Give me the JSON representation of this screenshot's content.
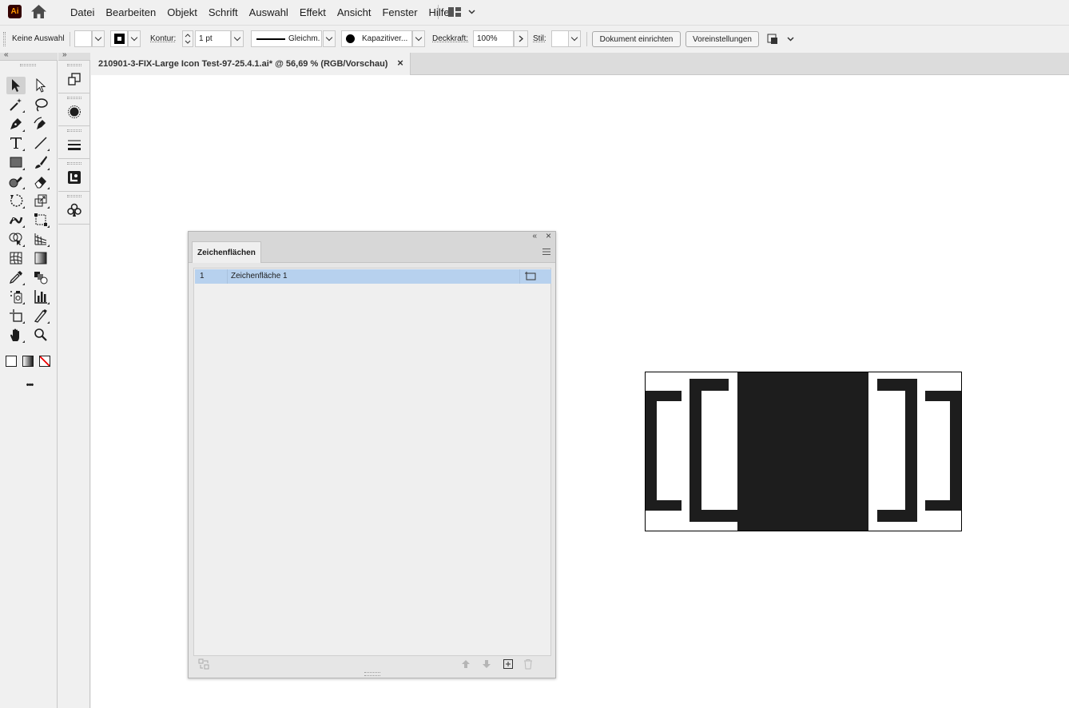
{
  "app": {
    "logo_text": "Ai",
    "brand_color": "#ff9a00",
    "logo_bg": "#330000"
  },
  "menu": {
    "items": [
      "Datei",
      "Bearbeiten",
      "Objekt",
      "Schrift",
      "Auswahl",
      "Effekt",
      "Ansicht",
      "Fenster",
      "Hilfe"
    ]
  },
  "control_bar": {
    "selection_status": "Keine Auswahl",
    "stroke_label": "Kontur:",
    "stroke_weight": "1 pt",
    "stroke_profile": "Gleichm.",
    "brush_label": "Kapazitiver...",
    "opacity_label": "Deckkraft:",
    "opacity_value": "100%",
    "style_label": "Stil:",
    "document_setup_button": "Dokument einrichten",
    "preferences_button": "Voreinstellungen"
  },
  "toolbar": {
    "collapse_icon": "«",
    "tools": [
      "selection-tool",
      "direct-selection-tool",
      "magic-wand-tool",
      "lasso-tool",
      "pen-tool",
      "curvature-tool",
      "type-tool",
      "line-segment-tool",
      "rectangle-tool",
      "paintbrush-tool",
      "shaper-tool",
      "eraser-tool",
      "rotate-tool",
      "scale-tool",
      "puppet-warp-tool",
      "free-transform-tool",
      "shape-builder-tool",
      "perspective-grid-tool",
      "mesh-tool",
      "gradient-tool",
      "eyedropper-tool",
      "blend-tool",
      "symbol-sprayer-tool",
      "column-graph-tool",
      "artboard-tool",
      "slice-tool",
      "hand-tool",
      "zoom-tool"
    ],
    "more_label": "•••"
  },
  "panel_strip": {
    "collapse_icon": "»",
    "panels": [
      "artboards-panel-icon",
      "appearance-panel-icon",
      "stroke-panel-icon",
      "libraries-panel-icon",
      "symbols-panel-icon"
    ]
  },
  "document": {
    "tab_title": "210901-3-FIX-Large Icon Test-97-25.4.1.ai* @ 56,69 % (RGB/Vorschau)",
    "close_icon": "×"
  },
  "artboards_panel": {
    "title": "Zeichenflächen",
    "collapse_icon": "«",
    "close_icon": "×",
    "rows": [
      {
        "number": "1",
        "name": "Zeichenfläche 1"
      }
    ],
    "selected_row_color": "#b7d1ee"
  },
  "artwork": {
    "fill_color": "#1d1d1d"
  }
}
